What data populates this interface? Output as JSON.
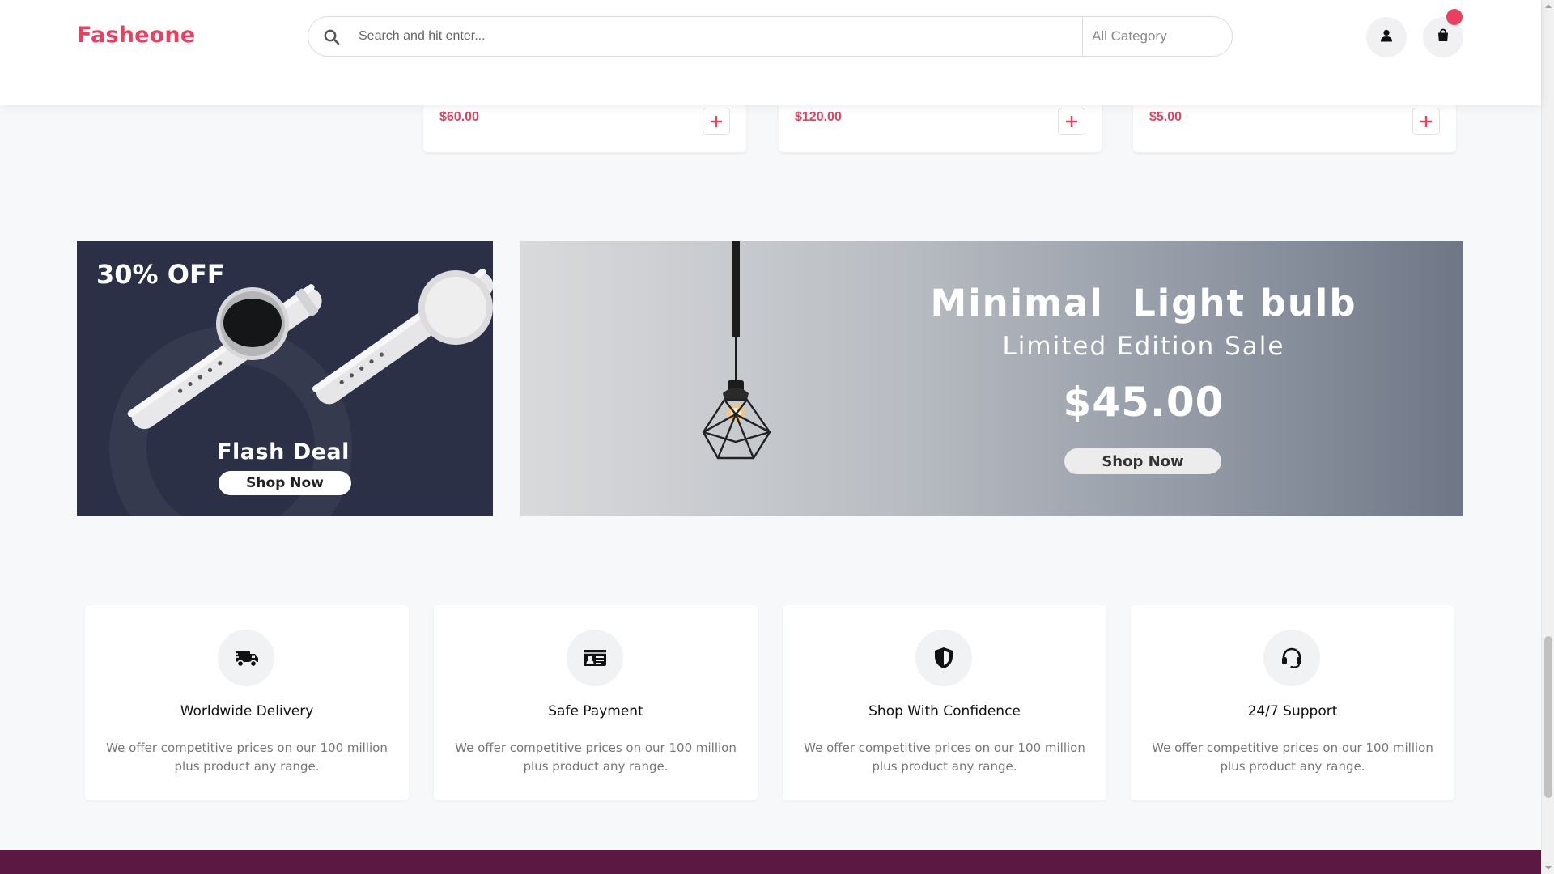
{
  "header": {
    "logo": "Fasheone",
    "search_placeholder": "Search and hit enter...",
    "category_label": "All Category",
    "icons": [
      "search-icon",
      "user-icon",
      "cart-icon"
    ],
    "accent_color": "#e8405e"
  },
  "products": [
    {
      "price": "$60.00"
    },
    {
      "price": "$120.00"
    },
    {
      "price": "$5.00"
    }
  ],
  "banners": {
    "flash": {
      "discount": "30% OFF",
      "title": "Flash Deal",
      "button": "Shop Now",
      "background": "#2b3046"
    },
    "bulb": {
      "title": "Minimal  Light bulb",
      "subtitle": "Limited Edition Sale",
      "price": "$45.00",
      "button": "Shop Now"
    }
  },
  "features": [
    {
      "icon": "delivery-truck-icon",
      "title": "Worldwide Delivery",
      "desc": "We offer competitive prices on our 100 million plus product any range."
    },
    {
      "icon": "id-card-icon",
      "title": "Safe Payment",
      "desc": "We offer competitive prices on our 100 million plus product any range."
    },
    {
      "icon": "shield-icon",
      "title": "Shop With Confidence",
      "desc": "We offer competitive prices on our 100 million plus product any range."
    },
    {
      "icon": "headset-icon",
      "title": "24/7 Support",
      "desc": "We offer competitive prices on our 100 million plus product any range."
    }
  ],
  "footer": {
    "color": "#5b1843"
  }
}
